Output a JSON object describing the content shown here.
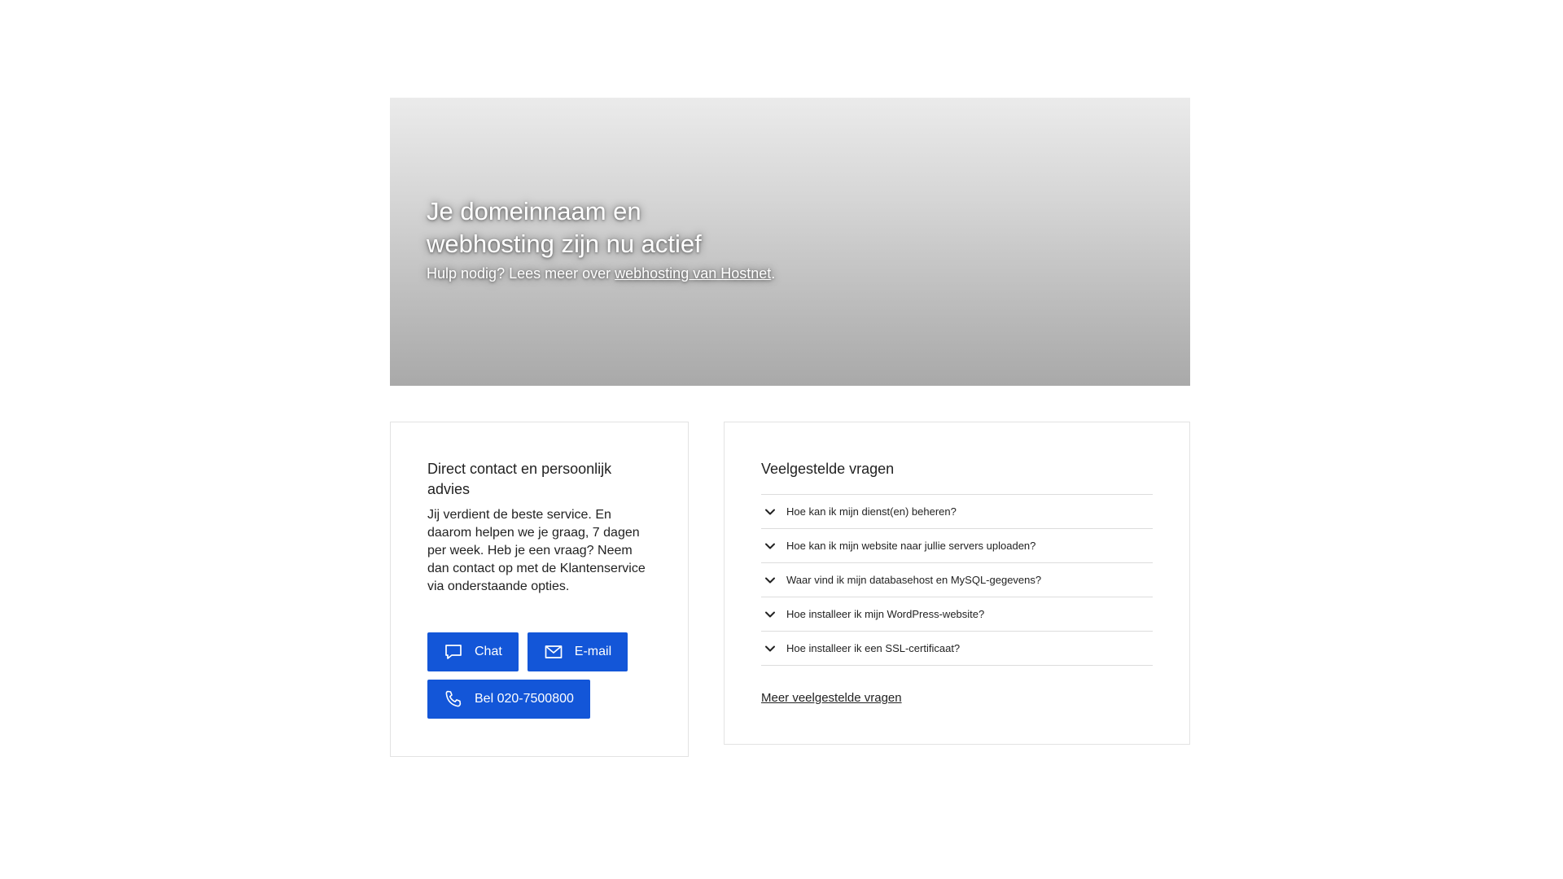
{
  "hero": {
    "title": "Je domeinnaam en webhosting zijn nu actief",
    "subtitle_prefix": "Hulp nodig? Lees meer over ",
    "subtitle_link": "webhosting van Hostnet",
    "subtitle_suffix": "."
  },
  "contact": {
    "title": "Direct contact en persoonlijk advies",
    "text": "Jij verdient de beste service. En daarom helpen we je graag, 7 dagen per week. Heb je een vraag? Neem dan contact op met de Klantenservice via onderstaande opties.",
    "buttons": {
      "chat": {
        "label": "Chat",
        "icon": "chat-bubble-icon"
      },
      "email": {
        "label": "E-mail",
        "icon": "mail-icon"
      },
      "phone": {
        "label": "Bel 020-7500800",
        "icon": "phone-icon"
      }
    },
    "button_color": "#1356d8"
  },
  "faq": {
    "title": "Veelgestelde vragen",
    "items": [
      {
        "label": "Hoe kan ik mijn dienst(en) beheren?"
      },
      {
        "label": "Hoe kan ik mijn website naar jullie servers uploaden?"
      },
      {
        "label": "Waar vind ik mijn databasehost en MySQL-gegevens?"
      },
      {
        "label": "Hoe installeer ik mijn WordPress-website?"
      },
      {
        "label": "Hoe installeer ik een SSL-certificaat?"
      }
    ],
    "more_link": "Meer veelgestelde vragen"
  }
}
